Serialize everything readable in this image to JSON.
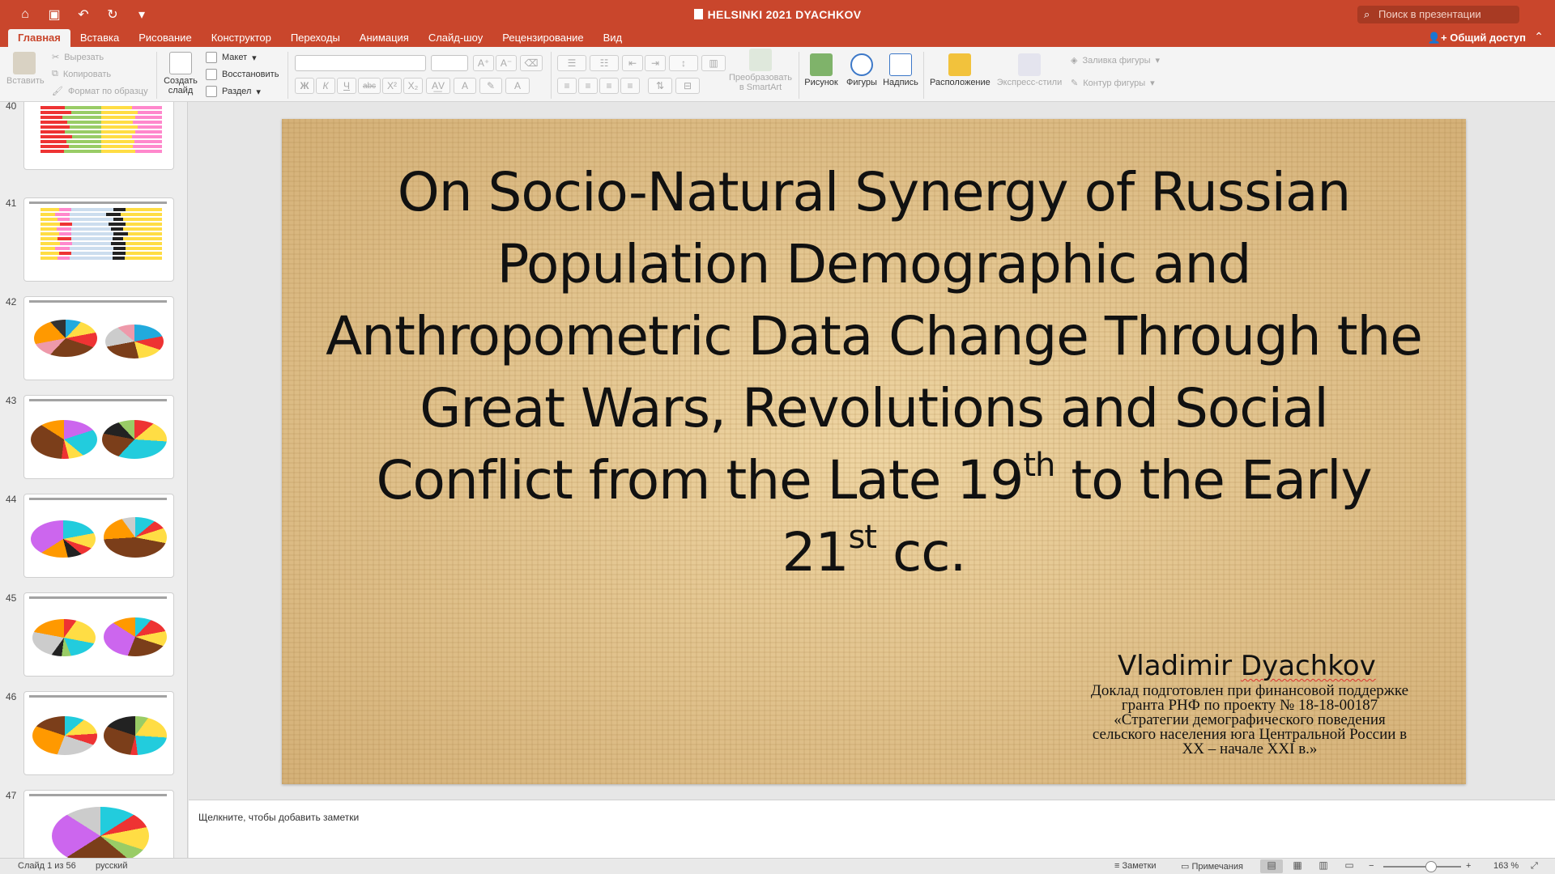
{
  "window": {
    "title": "HELSINKI 2021 DYACHKOV",
    "search_placeholder": "Поиск в презентации"
  },
  "tabs": [
    "Главная",
    "Вставка",
    "Рисование",
    "Конструктор",
    "Переходы",
    "Анимация",
    "Слайд-шоу",
    "Рецензирование",
    "Вид"
  ],
  "share_label": "Общий доступ",
  "ribbon": {
    "paste": "Вставить",
    "cut": "Вырезать",
    "copy": "Копировать",
    "format_painter": "Формат по образцу",
    "new_slide_1": "Создать",
    "new_slide_2": "слайд",
    "layout": "Макет",
    "reset": "Восстановить",
    "section": "Раздел",
    "smartart_1": "Преобразовать",
    "smartart_2": "в SmartArt",
    "picture": "Рисунок",
    "shapes": "Фигуры",
    "textbox": "Надпись",
    "arrange": "Расположение",
    "quick_styles": "Экспресс-стили",
    "shape_fill": "Заливка фигуры",
    "shape_outline": "Контур фигуры",
    "bold": "Ж",
    "italic": "К",
    "underline": "Ч",
    "strike": "abc",
    "superscript": "X²",
    "subscript": "X₂"
  },
  "thumbnails": [
    {
      "num": "40"
    },
    {
      "num": "41"
    },
    {
      "num": "42"
    },
    {
      "num": "43"
    },
    {
      "num": "44"
    },
    {
      "num": "45"
    },
    {
      "num": "46"
    },
    {
      "num": "47"
    }
  ],
  "slide": {
    "title_line1": "On Socio-Natural Synergy of Russian",
    "title_line2": "Population Demographic and",
    "title_line3": "Anthropometric Data Change Through the",
    "title_line4": "Great Wars, Revolutions and Social",
    "title_line5a": "Conflict from the Late 19",
    "title_line5_sup": "th",
    "title_line5b": " to the Early",
    "title_line6a": "21",
    "title_line6_sup": "st",
    "title_line6b": " cc.",
    "author_first": "Vladimir ",
    "author_last": "Dyachkov",
    "grant_line1": "Доклад подготовлен при финансовой поддержке",
    "grant_line2": "гранта РНФ по проекту № 18-18-00187",
    "grant_line3": "«Стратегии демографического поведения",
    "grant_line4": "сельского населения юга Центральной России в",
    "grant_line5": "XX – начале XXI в.»"
  },
  "notes_placeholder": "Щелкните, чтобы добавить заметки",
  "status": {
    "slide_counter": "Слайд 1 из 56",
    "language": "русский",
    "notes": "Заметки",
    "comments": "Примечания",
    "zoom": "163 %",
    "zoom_minus": "−",
    "zoom_plus": "+"
  },
  "colors": {
    "accent": "#c9462c",
    "slide_bg": "#e6c78f"
  }
}
